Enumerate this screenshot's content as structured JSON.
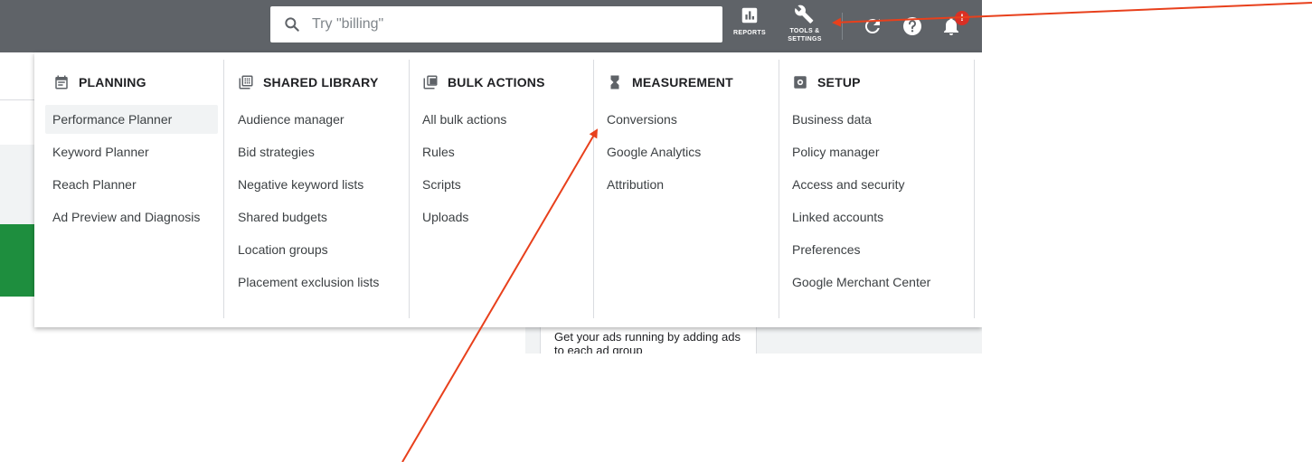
{
  "search": {
    "placeholder": "Try \"billing\""
  },
  "toolbar": {
    "reports_label": "REPORTS",
    "tools_label_line1": "TOOLS &",
    "tools_label_line2": "SETTINGS",
    "notification_badge": "!"
  },
  "menu": {
    "planning": {
      "title": "PLANNING",
      "icon": "calendar-icon",
      "items": [
        "Performance Planner",
        "Keyword Planner",
        "Reach Planner",
        "Ad Preview and Diagnosis"
      ]
    },
    "shared_library": {
      "title": "SHARED LIBRARY",
      "icon": "library-icon",
      "items": [
        "Audience manager",
        "Bid strategies",
        "Negative keyword lists",
        "Shared budgets",
        "Location groups",
        "Placement exclusion lists"
      ]
    },
    "bulk_actions": {
      "title": "BULK ACTIONS",
      "icon": "copy-icon",
      "items": [
        "All bulk actions",
        "Rules",
        "Scripts",
        "Uploads"
      ]
    },
    "measurement": {
      "title": "MEASUREMENT",
      "icon": "hourglass-icon",
      "items": [
        "Conversions",
        "Google Analytics",
        "Attribution"
      ]
    },
    "setup": {
      "title": "SETUP",
      "icon": "settings-box-icon",
      "items": [
        "Business data",
        "Policy manager",
        "Access and security",
        "Linked accounts",
        "Preferences",
        "Google Merchant Center"
      ]
    }
  },
  "background": {
    "card_text": "Get your ads running by adding ads to each ad group"
  },
  "colors": {
    "topbar": "#5f6368",
    "annotation_arrow": "#e8401c",
    "badge": "#d93025",
    "green_block": "#1e8e3e"
  }
}
